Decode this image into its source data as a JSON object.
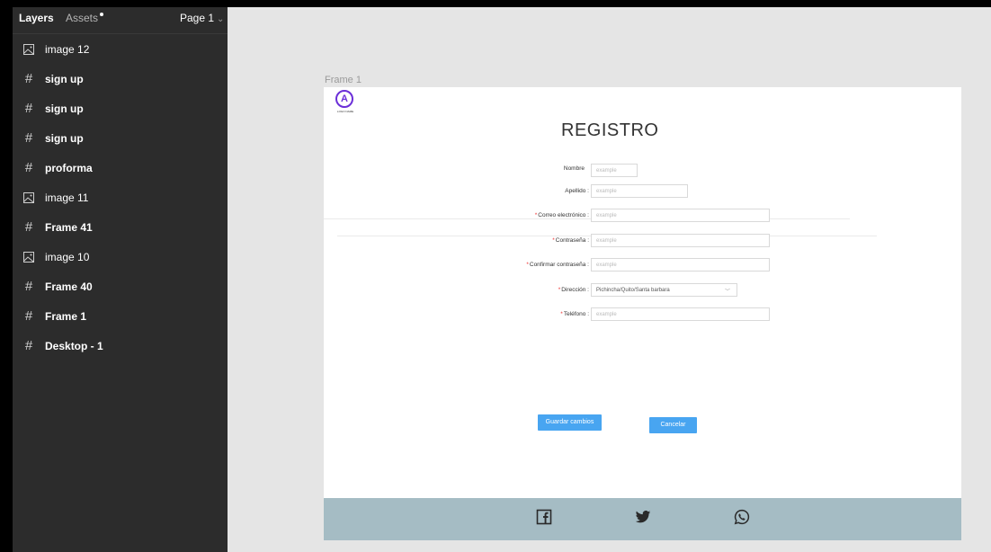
{
  "sidebar": {
    "tabs": {
      "layers": "Layers",
      "assets": "Assets"
    },
    "page_select": "Page 1",
    "layers": [
      {
        "icon": "image-icon",
        "label": "image 12",
        "bold": false
      },
      {
        "icon": "frame-icon",
        "label": "sign up",
        "bold": true
      },
      {
        "icon": "frame-icon",
        "label": "sign up",
        "bold": true
      },
      {
        "icon": "frame-icon",
        "label": "sign up",
        "bold": true
      },
      {
        "icon": "frame-icon",
        "label": "proforma",
        "bold": true
      },
      {
        "icon": "image-icon",
        "label": "image 11",
        "bold": false
      },
      {
        "icon": "frame-icon",
        "label": "Frame 41",
        "bold": true
      },
      {
        "icon": "image-icon",
        "label": "image 10",
        "bold": false
      },
      {
        "icon": "frame-icon",
        "label": "Frame 40",
        "bold": true
      },
      {
        "icon": "frame-icon",
        "label": "Frame 1",
        "bold": true
      },
      {
        "icon": "frame-icon",
        "label": "Desktop - 1",
        "bold": true
      }
    ]
  },
  "canvas": {
    "frame_label": "Frame 1",
    "logo": {
      "letter": "A",
      "text": "LOGO NAME"
    },
    "title": "REGISTRO",
    "form": {
      "nombre": {
        "label": "Nombre",
        "required": false,
        "placeholder": "example"
      },
      "apellido": {
        "label": "Apellido :",
        "required": false,
        "placeholder": "example"
      },
      "correo": {
        "label": "Correo electrónico :",
        "required": true,
        "placeholder": "example"
      },
      "contrasena": {
        "label": "Contraseña :",
        "required": true,
        "placeholder": "example"
      },
      "confirmar": {
        "label": "Confirmar contraseña :",
        "required": true,
        "placeholder": "example"
      },
      "direccion": {
        "label": "Dirección :",
        "required": true,
        "value": "Pichincha/Quito/Santa barbara"
      },
      "telefono": {
        "label": "Teléfono :",
        "required": true,
        "placeholder": "example"
      },
      "required_mark": "*"
    },
    "buttons": {
      "save": "Guardar cambios",
      "cancel": "Cancelar"
    },
    "footer_icons": [
      "facebook-icon",
      "twitter-icon",
      "whatsapp-icon"
    ]
  },
  "colors": {
    "accent": "#48a5f1",
    "footer": "#a5bcc4",
    "logo": "#6b2fd8",
    "required": "#ee3333"
  }
}
